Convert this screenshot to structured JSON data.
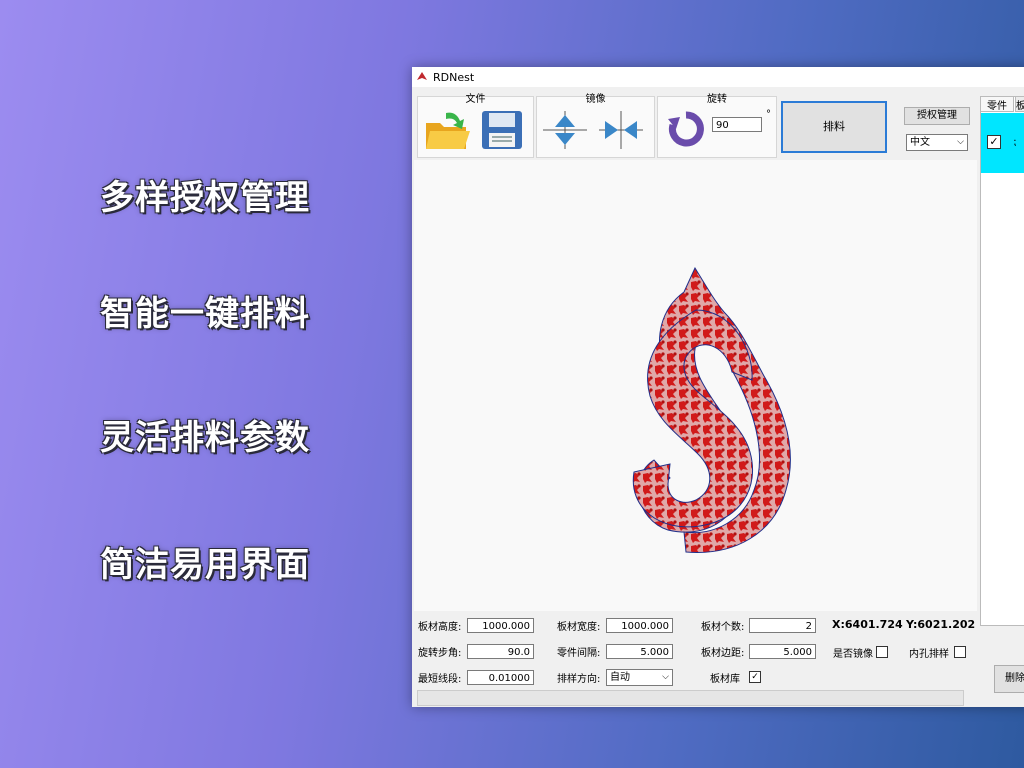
{
  "features": [
    "多样授权管理",
    "智能一键排料",
    "灵活排料参数",
    "简洁易用界面"
  ],
  "window": {
    "title": "RDNest"
  },
  "toolbar": {
    "file_label": "文件",
    "mirror_label": "镜像",
    "rotate_label": "旋转",
    "rotate_value": "90",
    "degree_symbol": "°",
    "nest_button": "排料",
    "license_button": "授权管理",
    "language": "中文"
  },
  "side_panel": {
    "tabs": [
      "零件",
      "板"
    ],
    "delete_button": "删除"
  },
  "params": {
    "sheet_height_label": "板材高度:",
    "sheet_height": "1000.000",
    "sheet_width_label": "板材宽度:",
    "sheet_width": "1000.000",
    "sheet_count_label": "板材个数:",
    "sheet_count": "2",
    "rotate_step_label": "旋转步角:",
    "rotate_step": "90.0",
    "part_gap_label": "零件间隔:",
    "part_gap": "5.000",
    "sheet_margin_label": "板材边距:",
    "sheet_margin": "5.000",
    "min_segment_label": "最短线段:",
    "min_segment": "0.01000",
    "nest_direction_label": "排样方向:",
    "nest_direction": "自动",
    "mirror_check_label": "是否镜像",
    "inner_hole_label": "内孔排样",
    "sheet_lib_label": "板材库",
    "coord_x": "X:6401.724",
    "coord_y": "Y:6021.202"
  },
  "colors": {
    "accent": "#00e6ff",
    "part_fill": "#d11a1a",
    "outline": "#1f2f8a"
  }
}
